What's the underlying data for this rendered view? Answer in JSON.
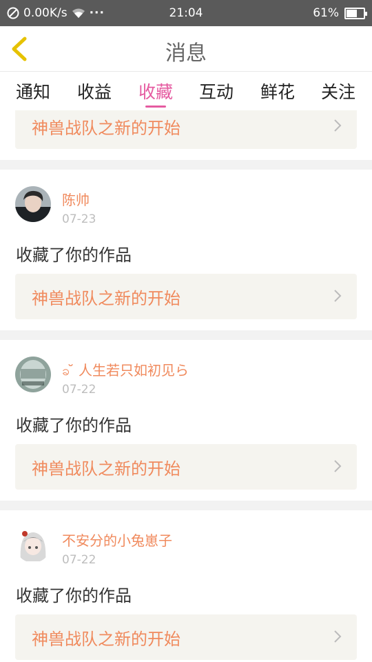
{
  "status": {
    "speed": "0.00K/s",
    "dots": "···",
    "time": "21:04",
    "battery": "61%",
    "battery_level": 0.61,
    "icons": [
      "no-disturb-icon",
      "wifi-icon",
      "battery-icon"
    ]
  },
  "header": {
    "title": "消息",
    "back_icon": "chevron-left-icon"
  },
  "tabs": [
    {
      "label": "通知"
    },
    {
      "label": "收益"
    },
    {
      "label": "收藏",
      "active": true
    },
    {
      "label": "互动"
    },
    {
      "label": "鲜花"
    },
    {
      "label": "关注"
    }
  ],
  "colors": {
    "accent": "#e55aa0",
    "orange": "#f08a5d",
    "back": "#e6c200"
  },
  "partial_item": {
    "work_title": "神兽战队之新的开始"
  },
  "items": [
    {
      "user": "陈帅",
      "date": "07-23",
      "action": "收藏了你的作品",
      "work_title": "神兽战队之新的开始"
    },
    {
      "user": "ခ  ̆  人生若只如初见ら",
      "date": "07-22",
      "action": "收藏了你的作品",
      "work_title": "神兽战队之新的开始"
    },
    {
      "user": "不安分的小兔崽子",
      "date": "07-22",
      "action": "收藏了你的作品",
      "work_title": "神兽战队之新的开始"
    }
  ]
}
